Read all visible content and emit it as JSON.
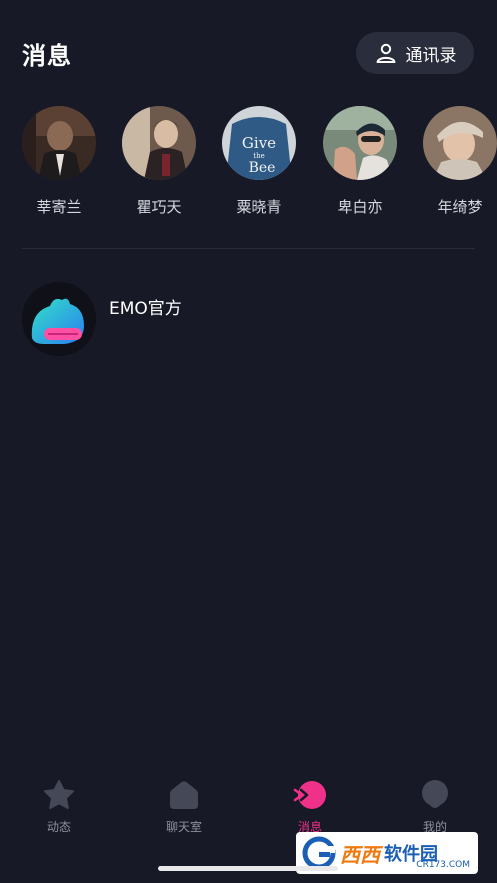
{
  "header": {
    "title": "消息",
    "contacts_label": "通讯录"
  },
  "stories": [
    {
      "name": "莘寄兰"
    },
    {
      "name": "瞿巧天"
    },
    {
      "name": "粟晓青"
    },
    {
      "name": "卑白亦"
    },
    {
      "name": "年绮梦"
    }
  ],
  "conversations": [
    {
      "title": "EMO官方"
    }
  ],
  "tabbar": {
    "items": [
      {
        "label": "动态",
        "icon": "star-icon",
        "active": false
      },
      {
        "label": "聊天室",
        "icon": "house-icon",
        "active": false
      },
      {
        "label": "消息",
        "icon": "message-icon",
        "active": true
      },
      {
        "label": "我的",
        "icon": "profile-icon",
        "active": false
      }
    ],
    "active_color": "#f0318a",
    "inactive_color": "#8e909c"
  },
  "watermark": {
    "text_main": "西西",
    "text_soft": "软件园",
    "url": "CR173.COM"
  }
}
